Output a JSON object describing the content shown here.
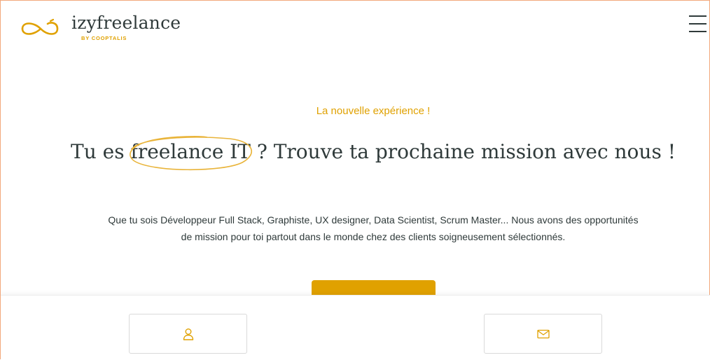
{
  "brand": {
    "name": "izyfreelance",
    "tagline": "BY COOPTALIS",
    "accent": "#e0a100",
    "text_color": "#2f3a3a"
  },
  "header": {
    "menu_icon": "hamburger-menu-icon"
  },
  "hero": {
    "kicker": "La nouvelle expérience !",
    "title_before": "Tu es ",
    "title_highlight": "freelance IT",
    "title_after": " ? Trouve ta prochaine mission avec nous !",
    "description": "Que tu sois Développeur Full Stack, Graphiste, UX designer, Data Scientist, Scrum Master... Nous avons des opportunités de mission pour toi partout dans le monde chez des clients soigneusement sélectionnés."
  },
  "bottom_bar": {
    "left_icon": "user-icon",
    "right_icon": "mail-icon"
  }
}
